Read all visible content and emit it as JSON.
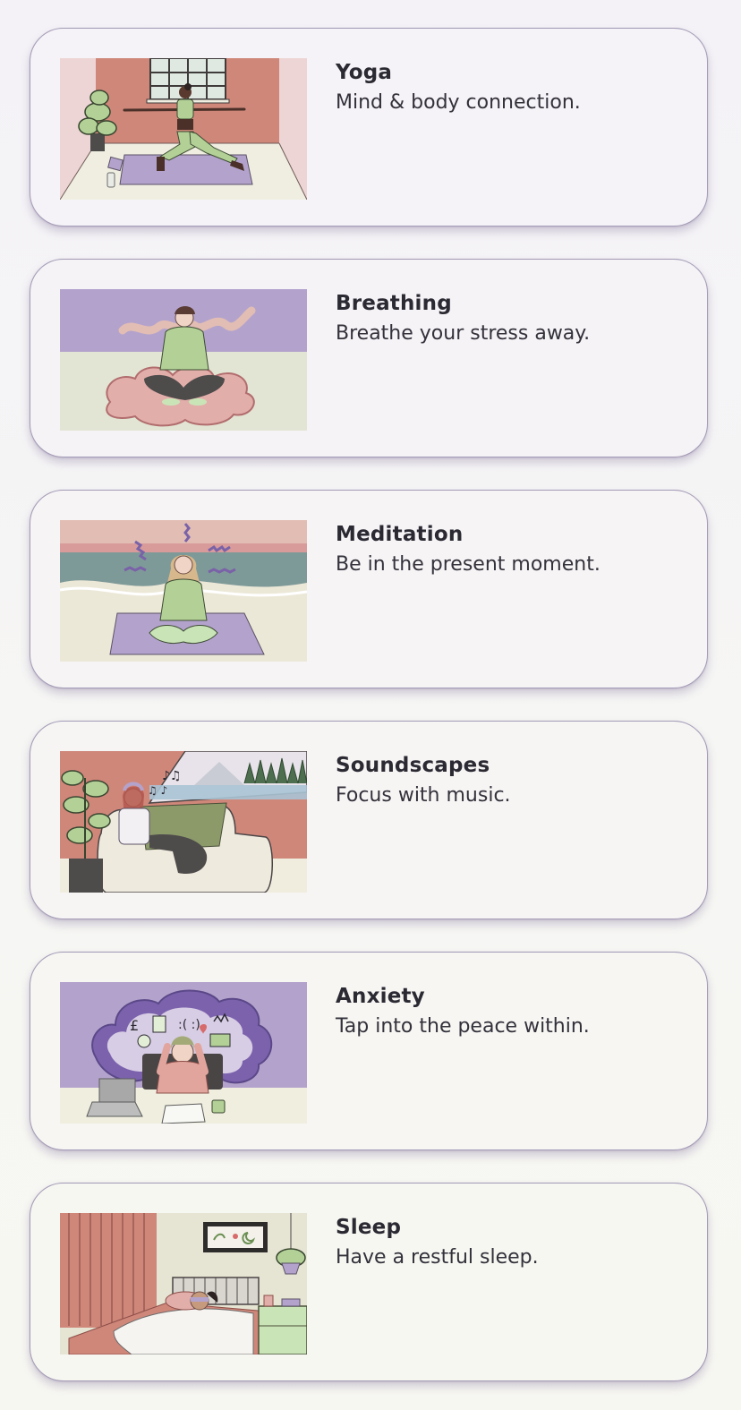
{
  "cards": [
    {
      "title": "Yoga",
      "description": "Mind & body connection.",
      "illustration": "yoga-illustration"
    },
    {
      "title": "Breathing",
      "description": "Breathe your stress away.",
      "illustration": "breathing-illustration"
    },
    {
      "title": "Meditation",
      "description": "Be in the present moment.",
      "illustration": "meditation-illustration"
    },
    {
      "title": "Soundscapes",
      "description": "Focus with music.",
      "illustration": "soundscapes-illustration"
    },
    {
      "title": "Anxiety",
      "description": "Tap into the peace within.",
      "illustration": "anxiety-illustration"
    },
    {
      "title": "Sleep",
      "description": "Have a restful sleep.",
      "illustration": "sleep-illustration"
    }
  ],
  "colors": {
    "card_border": "#a49bb6",
    "lavender": "#b3a3cc",
    "terracotta": "#cf877a",
    "sage": "#b3d197",
    "cream": "#efeee1"
  }
}
